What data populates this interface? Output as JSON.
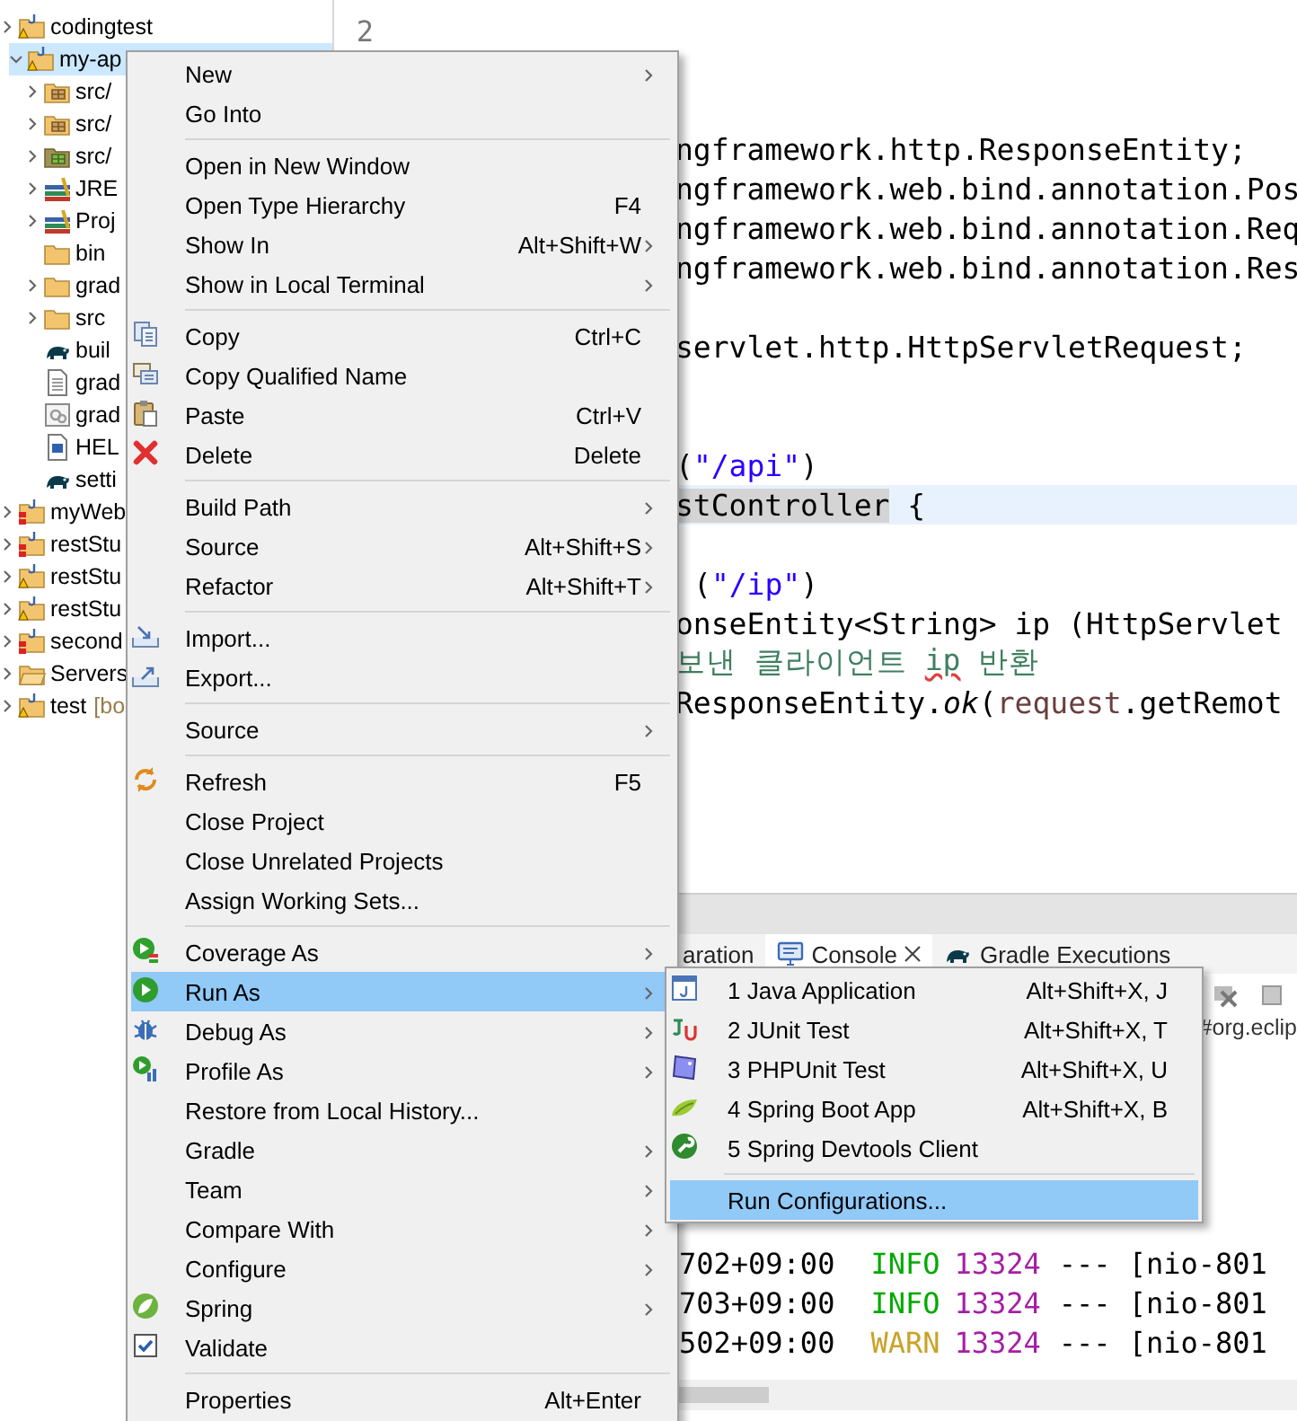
{
  "project_tree": [
    {
      "label": "codingtest",
      "kind": "project",
      "expanded": false,
      "selected": false
    },
    {
      "label": "my-ap",
      "kind": "project",
      "expanded": true,
      "selected": true,
      "children": [
        {
          "label": "src/",
          "kind": "package-folder",
          "expanded": false,
          "selected": false
        },
        {
          "label": "src/",
          "kind": "package-folder",
          "expanded": false,
          "selected": false
        },
        {
          "label": "src/",
          "kind": "test-folder",
          "expanded": false,
          "selected": false
        },
        {
          "label": "JRE",
          "kind": "library",
          "expanded": false,
          "selected": false
        },
        {
          "label": "Proj",
          "kind": "library",
          "expanded": false,
          "selected": false
        },
        {
          "label": "bin",
          "kind": "folder",
          "selected": false
        },
        {
          "label": "grad",
          "kind": "folder",
          "expanded": false,
          "selected": false
        },
        {
          "label": "src",
          "kind": "folder",
          "expanded": false,
          "selected": false
        },
        {
          "label": "buil",
          "kind": "gradle",
          "selected": false
        },
        {
          "label": "grad",
          "kind": "file",
          "selected": false
        },
        {
          "label": "grad",
          "kind": "config",
          "selected": false
        },
        {
          "label": "HEL",
          "kind": "word",
          "selected": false
        },
        {
          "label": "setti",
          "kind": "gradle",
          "selected": false
        }
      ]
    },
    {
      "label": "myWeb",
      "kind": "project-error",
      "expanded": false,
      "selected": false
    },
    {
      "label": "restStu",
      "kind": "project-error",
      "expanded": false,
      "selected": false
    },
    {
      "label": "restStu",
      "kind": "project",
      "expanded": false,
      "selected": false
    },
    {
      "label": "restStu",
      "kind": "project",
      "expanded": false,
      "selected": false
    },
    {
      "label": "second",
      "kind": "project-error",
      "expanded": false,
      "selected": false
    },
    {
      "label": "Servers",
      "kind": "folder-open",
      "expanded": false,
      "selected": false
    },
    {
      "label": "test",
      "decoration": "[bo",
      "kind": "project",
      "expanded": false,
      "selected": false
    }
  ],
  "editor": {
    "lines": [
      {
        "number": "2",
        "current": false
      },
      {
        "current": false
      },
      {
        "current": false
      },
      {
        "current": false,
        "segments": [
          {
            "text": "ngframework.http.ResponseEntity;",
            "kind": "plain"
          }
        ]
      },
      {
        "current": false,
        "segments": [
          {
            "text": "ngframework.web.bind.annotation.Pos",
            "kind": "plain"
          }
        ]
      },
      {
        "current": false,
        "segments": [
          {
            "text": "ngframework.web.bind.annotation.Req",
            "kind": "plain"
          }
        ]
      },
      {
        "current": false,
        "segments": [
          {
            "text": "ngframework.web.bind.annotation.Res",
            "kind": "plain"
          }
        ]
      },
      {
        "current": false
      },
      {
        "current": false,
        "segments": [
          {
            "text": "servlet.http.HttpServletRequest;",
            "kind": "plain"
          }
        ]
      },
      {
        "current": false
      },
      {
        "current": false
      },
      {
        "current": false,
        "segments": [
          {
            "text": "(",
            "kind": "plain"
          },
          {
            "text": "\"/api\"",
            "kind": "string"
          },
          {
            "text": ")",
            "kind": "plain"
          }
        ]
      },
      {
        "current": true,
        "segments": [
          {
            "text": "stController",
            "kind": "occurrence"
          },
          {
            "text": " {",
            "kind": "plain"
          }
        ]
      },
      {
        "current": false
      },
      {
        "current": false,
        "segments": [
          {
            "text": "(",
            "kind": "plain"
          },
          {
            "text": "\"/ip\"",
            "kind": "string"
          },
          {
            "text": ")",
            "kind": "plain"
          }
        ]
      },
      {
        "current": false,
        "segments": [
          {
            "text": "onseEntity<String> ip (HttpServlet",
            "kind": "plain"
          }
        ]
      },
      {
        "current": false,
        "segments": [
          {
            "text": "보낸 클라이언트 ",
            "kind": "comment"
          },
          {
            "text": "ip",
            "kind": "misspelled"
          },
          {
            "text": " 반환",
            "kind": "comment"
          }
        ]
      },
      {
        "current": false,
        "segments": [
          {
            "text": "ResponseEntity.",
            "kind": "plain"
          },
          {
            "text": "ok",
            "kind": "italic"
          },
          {
            "text": "(",
            "kind": "plain"
          },
          {
            "text": "request",
            "kind": "variable"
          },
          {
            "text": ".getRemot",
            "kind": "plain"
          }
        ]
      }
    ]
  },
  "bottom_panel": {
    "tabs": [
      {
        "label": "aration",
        "kind": "plain",
        "selected": false
      },
      {
        "label": "Console",
        "kind": "console",
        "selected": true
      },
      {
        "label": "Gradle Executions",
        "kind": "gradle",
        "selected": false
      }
    ],
    "description": "#org.eclip",
    "console_lines": [
      {
        "time": "702+09:00",
        "level": "INFO",
        "kind": "info",
        "pid": "13324",
        "dashes": "---",
        "thread": "[nio-801"
      },
      {
        "time": "703+09:00",
        "level": "INFO",
        "kind": "info",
        "pid": "13324",
        "dashes": "---",
        "thread": "[nio-801"
      },
      {
        "time": "502+09:00",
        "level": "WARN",
        "kind": "warn",
        "pid": "13324",
        "dashes": "---",
        "thread": "[nio-801"
      }
    ]
  },
  "context_menu": {
    "groups": [
      [
        {
          "label": "New",
          "kind": "plain",
          "submenu": true,
          "selected": false
        },
        {
          "label": "Go Into",
          "kind": "plain",
          "submenu": false,
          "selected": false
        }
      ],
      [
        {
          "label": "Open in New Window",
          "kind": "plain",
          "submenu": false,
          "selected": false
        },
        {
          "label": "Open Type Hierarchy",
          "kind": "plain",
          "shortcut": "F4",
          "submenu": false,
          "selected": false
        },
        {
          "label": "Show In",
          "kind": "plain",
          "shortcut": "Alt+Shift+W",
          "submenu": true,
          "selected": false
        },
        {
          "label": "Show in Local Terminal",
          "kind": "plain",
          "submenu": true,
          "selected": false
        }
      ],
      [
        {
          "label": "Copy",
          "kind": "copy",
          "shortcut": "Ctrl+C",
          "submenu": false,
          "selected": false
        },
        {
          "label": "Copy Qualified Name",
          "kind": "copy-name",
          "submenu": false,
          "selected": false
        },
        {
          "label": "Paste",
          "kind": "paste",
          "shortcut": "Ctrl+V",
          "submenu": false,
          "selected": false
        },
        {
          "label": "Delete",
          "kind": "delete",
          "shortcut": "Delete",
          "submenu": false,
          "selected": false
        }
      ],
      [
        {
          "label": "Build Path",
          "kind": "plain",
          "submenu": true,
          "selected": false
        },
        {
          "label": "Source",
          "kind": "plain",
          "shortcut": "Alt+Shift+S",
          "submenu": true,
          "selected": false
        },
        {
          "label": "Refactor",
          "kind": "plain",
          "shortcut": "Alt+Shift+T",
          "submenu": true,
          "selected": false
        }
      ],
      [
        {
          "label": "Import...",
          "kind": "import",
          "submenu": false,
          "selected": false
        },
        {
          "label": "Export...",
          "kind": "export",
          "submenu": false,
          "selected": false
        }
      ],
      [
        {
          "label": "Source",
          "kind": "plain",
          "submenu": true,
          "selected": false
        }
      ],
      [
        {
          "label": "Refresh",
          "kind": "refresh",
          "shortcut": "F5",
          "submenu": false,
          "selected": false
        },
        {
          "label": "Close Project",
          "kind": "plain",
          "submenu": false,
          "selected": false
        },
        {
          "label": "Close Unrelated Projects",
          "kind": "plain",
          "submenu": false,
          "selected": false
        },
        {
          "label": "Assign Working Sets...",
          "kind": "plain",
          "submenu": false,
          "selected": false
        }
      ],
      [
        {
          "label": "Coverage As",
          "kind": "coverage",
          "submenu": true,
          "selected": false
        },
        {
          "label": "Run As",
          "kind": "run",
          "submenu": true,
          "selected": true
        },
        {
          "label": "Debug As",
          "kind": "debug",
          "submenu": true,
          "selected": false
        },
        {
          "label": "Profile As",
          "kind": "profile",
          "submenu": true,
          "selected": false
        },
        {
          "label": "Restore from Local History...",
          "kind": "plain",
          "submenu": false,
          "selected": false
        },
        {
          "label": "Gradle",
          "kind": "plain",
          "submenu": true,
          "selected": false
        },
        {
          "label": "Team",
          "kind": "plain",
          "submenu": true,
          "selected": false
        },
        {
          "label": "Compare With",
          "kind": "plain",
          "submenu": true,
          "selected": false
        },
        {
          "label": "Configure",
          "kind": "plain",
          "submenu": true,
          "selected": false
        },
        {
          "label": "Spring",
          "kind": "spring",
          "submenu": true,
          "selected": false
        },
        {
          "label": "Validate",
          "kind": "validate",
          "submenu": false,
          "selected": false
        }
      ],
      [
        {
          "label": "Properties",
          "kind": "plain",
          "shortcut": "Alt+Enter",
          "submenu": false,
          "selected": false
        }
      ]
    ]
  },
  "run_as_submenu": {
    "groups": [
      [
        {
          "label": "1 Java Application",
          "kind": "java",
          "shortcut": "Alt+Shift+X, J",
          "selected": false
        },
        {
          "label": "2 JUnit Test",
          "kind": "junit",
          "shortcut": "Alt+Shift+X, T",
          "selected": false
        },
        {
          "label": "3 PHPUnit Test",
          "kind": "phpunit",
          "shortcut": "Alt+Shift+X, U",
          "selected": false
        },
        {
          "label": "4 Spring Boot App",
          "kind": "spring-boot",
          "shortcut": "Alt+Shift+X, B",
          "selected": false
        },
        {
          "label": "5 Spring Devtools Client",
          "kind": "devtools",
          "selected": false
        }
      ],
      [
        {
          "label": "Run Configurations...",
          "kind": "plain",
          "selected": true
        }
      ]
    ]
  }
}
